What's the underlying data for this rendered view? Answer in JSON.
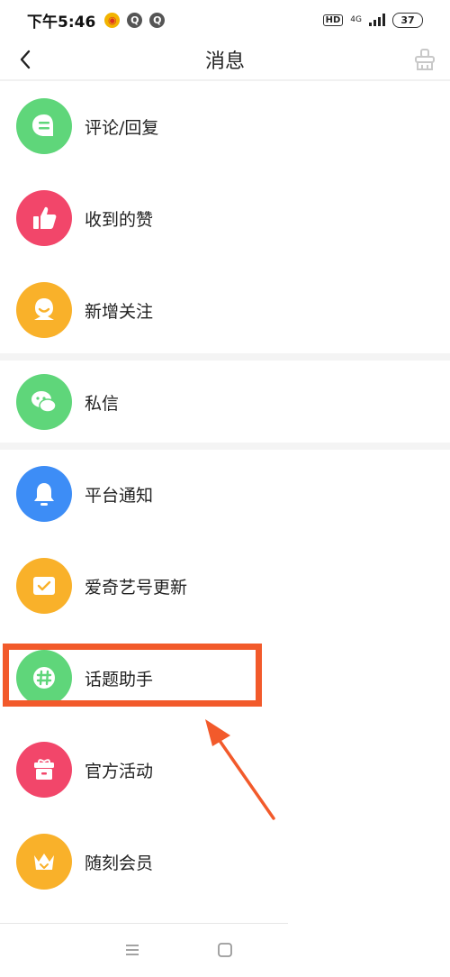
{
  "status_bar": {
    "time": "下午5:46",
    "hd": "HD",
    "network": "4G",
    "battery": "37"
  },
  "header": {
    "title": "消息"
  },
  "colors": {
    "accent_highlight": "#f25a2b",
    "green": "#5fd67a",
    "red": "#f2466a",
    "orange": "#f9b12a",
    "blue": "#3d8df6"
  },
  "menu": [
    {
      "label": "评论/回复",
      "icon": "comment-icon",
      "color": "green"
    },
    {
      "label": "收到的赞",
      "icon": "thumbs-up-icon",
      "color": "red"
    },
    {
      "label": "新增关注",
      "icon": "new-follower-icon",
      "color": "orange"
    },
    {
      "label": "私信",
      "icon": "chat-bubbles-icon",
      "color": "green"
    },
    {
      "label": "平台通知",
      "icon": "bell-icon",
      "color": "blue"
    },
    {
      "label": "爱奇艺号更新",
      "icon": "envelope-check-icon",
      "color": "orange"
    },
    {
      "label": "话题助手",
      "icon": "hashtag-icon",
      "color": "green"
    },
    {
      "label": "官方活动",
      "icon": "gift-box-icon",
      "color": "red"
    },
    {
      "label": "随刻会员",
      "icon": "crown-icon",
      "color": "orange"
    }
  ]
}
